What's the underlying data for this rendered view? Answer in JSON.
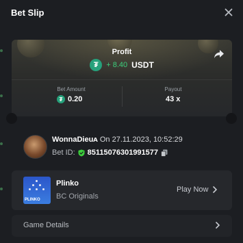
{
  "header": {
    "title": "Bet Slip"
  },
  "profit": {
    "label": "Profit",
    "amount": "+ 8.40",
    "currency": "USDT",
    "coin_glyph": "₮"
  },
  "stats": {
    "bet_amount_label": "Bet Amount",
    "bet_amount_value": "0.20",
    "payout_label": "Payout",
    "payout_value": "43 x"
  },
  "bet": {
    "username": "WonnaDieuᴀ",
    "date_prefix": "On",
    "datetime": "27.11.2023, 10:52:29",
    "id_label": "Bet ID:",
    "id_value": "85115076301991577"
  },
  "game": {
    "name": "Plinko",
    "provider": "BC Originals",
    "play_label": "Play Now",
    "thumb_label": "PLINKO"
  },
  "details": {
    "label": "Game Details"
  },
  "colors": {
    "background": "#1c1e22",
    "profit_green": "#3ccf7c",
    "usdt_green": "#26a17b",
    "card": "#26282c"
  },
  "icons": {
    "close": "close-icon",
    "share": "share-arrow-icon",
    "usdt": "usdt-coin-icon",
    "shield": "shield-check-icon",
    "copy": "copy-icon",
    "chevron": "chevron-right-icon"
  }
}
